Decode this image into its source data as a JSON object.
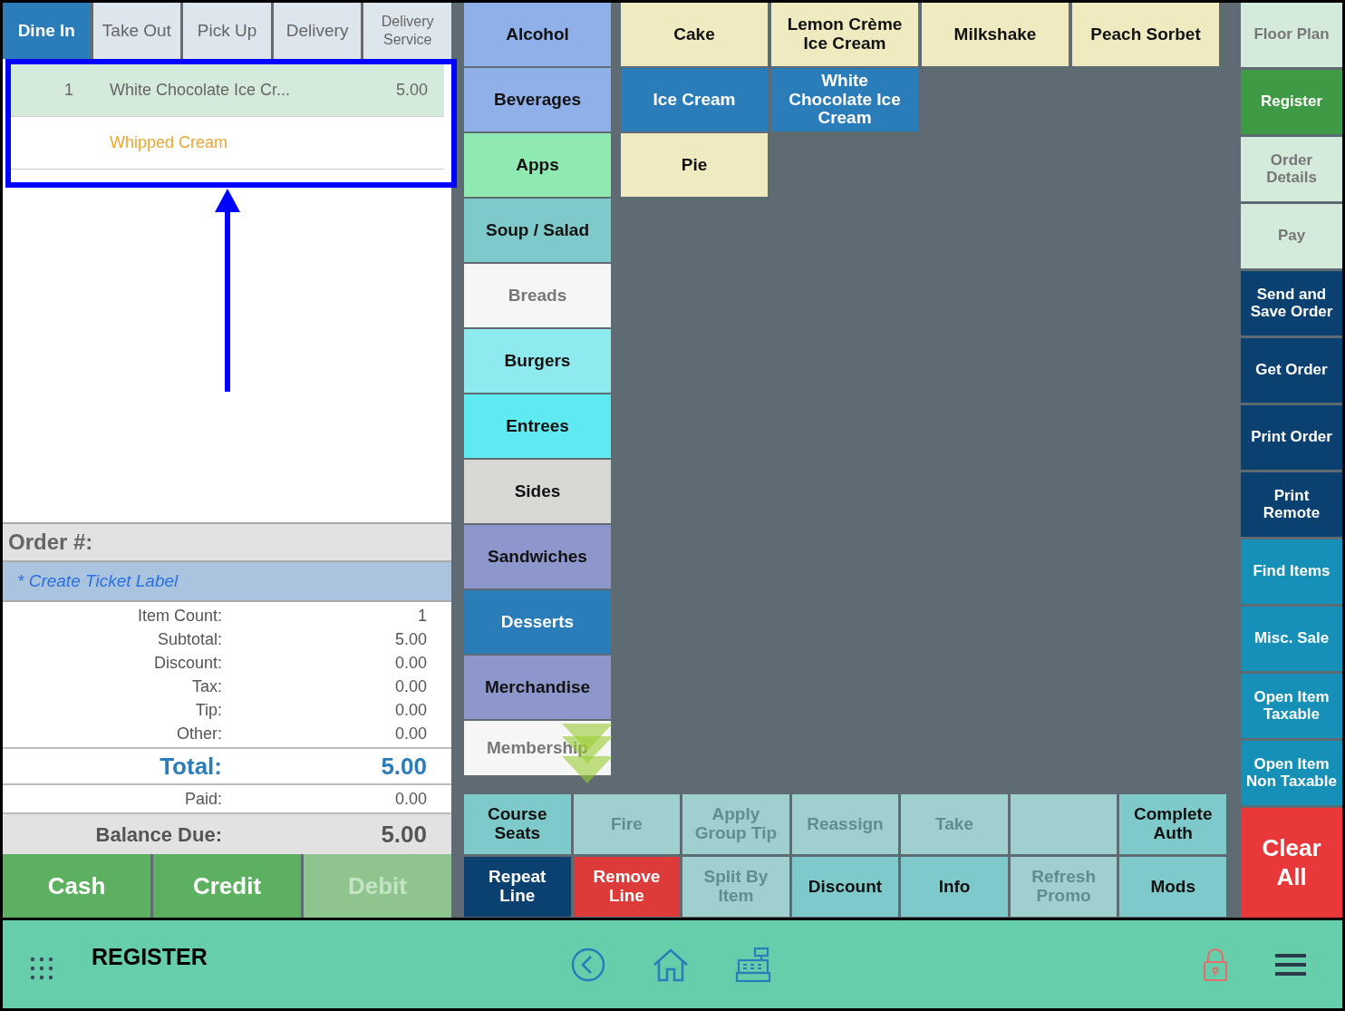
{
  "order_tabs": [
    {
      "label": "Dine In",
      "selected": true
    },
    {
      "label": "Take Out",
      "selected": false
    },
    {
      "label": "Pick Up",
      "selected": false
    },
    {
      "label": "Delivery",
      "selected": false
    },
    {
      "label": "Delivery Service",
      "selected": false
    }
  ],
  "order_lines": [
    {
      "kind": "item",
      "qty": "1",
      "name": "White Chocolate Ice Cr...",
      "price": "5.00",
      "selected": true
    },
    {
      "kind": "modifier",
      "name": "Whipped Cream",
      "selected": false
    }
  ],
  "order_number": {
    "label": "Order #:"
  },
  "ticket_label": {
    "text": "* Create Ticket Label"
  },
  "summary": [
    {
      "label": "Item Count:",
      "value": "1"
    },
    {
      "label": "Subtotal:",
      "value": "5.00"
    },
    {
      "label": "Discount:",
      "value": "0.00"
    },
    {
      "label": "Tax:",
      "value": "0.00"
    },
    {
      "label": "Tip:",
      "value": "0.00"
    },
    {
      "label": "Other:",
      "value": "0.00"
    }
  ],
  "total": {
    "label": "Total:",
    "value": "5.00"
  },
  "paid": {
    "label": "Paid:",
    "value": "0.00"
  },
  "balance_due": {
    "label": "Balance Due:",
    "value": "5.00"
  },
  "payment_buttons": [
    {
      "label": "Cash",
      "disabled": false
    },
    {
      "label": "Credit",
      "disabled": false
    },
    {
      "label": "Debit",
      "disabled": true
    }
  ],
  "categories": [
    {
      "label": "Alcohol",
      "color": "#8fb0e8"
    },
    {
      "label": "Beverages",
      "color": "#8fb0e8"
    },
    {
      "label": "Apps",
      "color": "#8eeab0"
    },
    {
      "label": "Soup / Salad",
      "color": "#7ecaca"
    },
    {
      "label": "Breads",
      "color": "#f6f6f6"
    },
    {
      "label": "Burgers",
      "color": "#8eeaee"
    },
    {
      "label": "Entrees",
      "color": "#5eeaf0"
    },
    {
      "label": "Sides",
      "color": "#d8d8d4"
    },
    {
      "label": "Sandwiches",
      "color": "#8e97cc"
    },
    {
      "label": "Desserts",
      "color": "#2a7db8"
    },
    {
      "label": "Merchandise",
      "color": "#8e97cc"
    },
    {
      "label": "Membership",
      "color": "#f6f6f6"
    }
  ],
  "item_rows": [
    {
      "items": [
        {
          "label": "Cake",
          "color": "#efeac0"
        },
        {
          "label": "Lemon Crème Ice Cream",
          "color": "#efeac0"
        },
        {
          "label": "Milkshake",
          "color": "#efeac0"
        },
        {
          "label": "Peach Sorbet",
          "color": "#efeac0"
        }
      ]
    },
    {
      "items": [
        {
          "label": "Ice Cream",
          "color": "#2a7db8"
        },
        {
          "label": "White Chocolate Ice Cream",
          "color": "#2a7db8"
        }
      ]
    },
    {
      "items": [
        {
          "label": "Pie",
          "color": "#efeac0"
        }
      ]
    }
  ],
  "actions": [
    {
      "label": "Course Seats",
      "color": "#7ecaca",
      "disabled": false
    },
    {
      "label": "Fire",
      "color": "#a0cfcf",
      "disabled": true
    },
    {
      "label": "Apply Group Tip",
      "color": "#a0cfcf",
      "disabled": true
    },
    {
      "label": "Reassign",
      "color": "#a0cfcf",
      "disabled": true
    },
    {
      "label": "Take",
      "color": "#a0cfcf",
      "disabled": true
    },
    {
      "color": "#a0cfcf"
    },
    {
      "label": "Complete Auth",
      "color": "#7ecaca",
      "disabled": false
    },
    {
      "label": "Repeat Line",
      "color": "#0b4170",
      "disabled": false
    },
    {
      "label": "Remove Line",
      "color": "#dd3a3a",
      "disabled": false
    },
    {
      "label": "Split By Item",
      "color": "#a0cfcf",
      "disabled": true
    },
    {
      "label": "Discount",
      "color": "#7ecaca",
      "disabled": false
    },
    {
      "label": "Info",
      "color": "#7ecaca",
      "disabled": false
    },
    {
      "label": "Refresh Promo",
      "color": "#a0cfcf",
      "disabled": true
    },
    {
      "label": "Mods",
      "color": "#7ecaca",
      "disabled": false
    }
  ],
  "side_buttons": [
    {
      "label": "Floor Plan",
      "color": "#d4eadb"
    },
    {
      "label": "Register",
      "color": "#3f9a45"
    },
    {
      "label": "Order Details",
      "color": "#d4eadb"
    },
    {
      "label": "Pay",
      "color": "#d4eadb"
    },
    {
      "label": "Send and Save Order",
      "color": "#0b4170"
    },
    {
      "label": "Get Order",
      "color": "#0b4170"
    },
    {
      "label": "Print Order",
      "color": "#0b4170"
    },
    {
      "label": "Print Remote",
      "color": "#0b4170"
    },
    {
      "label": "Find Items",
      "color": "#1790b8"
    },
    {
      "label": "Misc. Sale",
      "color": "#1790b8"
    },
    {
      "label": "Open Item Taxable",
      "color": "#1790b8"
    },
    {
      "label": "Open Item Non Taxable",
      "color": "#1790b8"
    },
    {
      "label": "Clear All",
      "color": "#e8383a"
    }
  ],
  "bottom_bar": {
    "title": "REGISTER"
  }
}
